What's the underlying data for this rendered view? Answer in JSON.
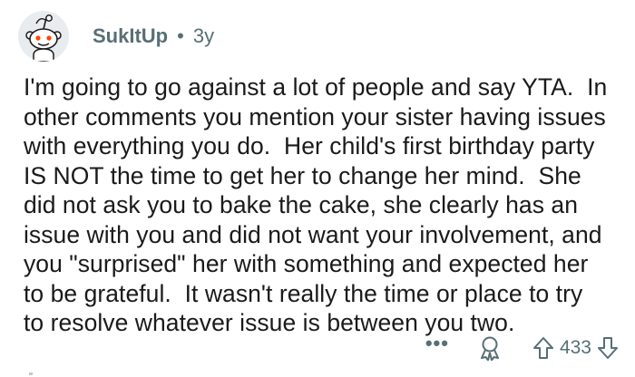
{
  "comment": {
    "username": "SukItUp",
    "separator": "•",
    "age": "3y",
    "body_lines": [
      "I'm going to go against a lot of people and say YTA.  In",
      "other comments you mention your sister having issues",
      "with everything you do.  Her child's first birthday party",
      "IS NOT the time to get her to change her mind.  She",
      "did not ask you to bake the cake, she clearly has an",
      "issue with you and did not want your involvement, and",
      "you \"surprised\" her with something and expected her",
      "to be grateful.  It wasn't really the time or place to try",
      "to resolve whatever issue is between you two."
    ],
    "actions": {
      "more_label": "•••",
      "vote_count": "433"
    }
  },
  "icons": {
    "avatar": "snoo-avatar-icon",
    "award": "award-icon",
    "upvote": "upvote-arrow-icon",
    "downvote": "downvote-arrow-icon"
  },
  "colors": {
    "meta_text": "#576f76",
    "body_text": "#1a1a1b",
    "avatar_bg": "#e9ecee",
    "snoo_accent": "#ff4500"
  }
}
